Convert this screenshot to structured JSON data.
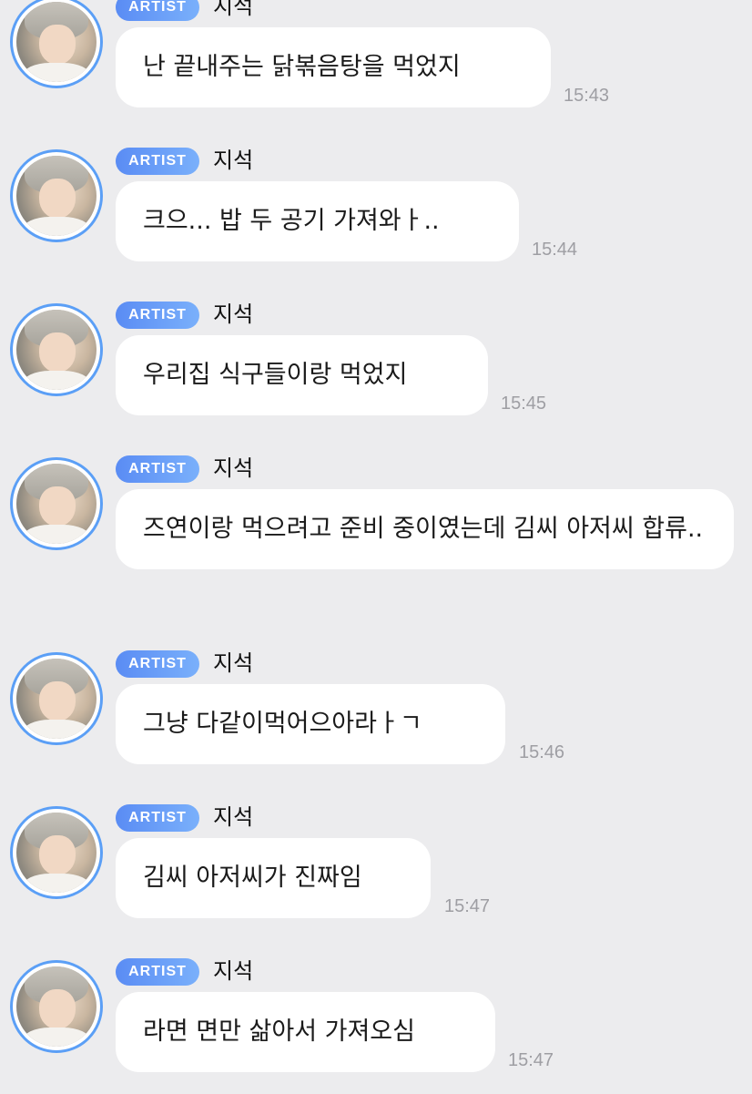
{
  "messages": [
    {
      "badge": "ARTIST",
      "sender": "지석",
      "text": "난 끝내주는 닭볶음탕을 먹었지",
      "time": "15:43"
    },
    {
      "badge": "ARTIST",
      "sender": "지석",
      "text": "크으... 밥 두 공기 가져와ㅏ..",
      "time": "15:44"
    },
    {
      "badge": "ARTIST",
      "sender": "지석",
      "text": "우리집 식구들이랑 먹었지",
      "time": "15:45"
    },
    {
      "badge": "ARTIST",
      "sender": "지석",
      "text": "즈연이랑 먹으려고 준비 중이였는데 김씨 아저씨 합류..",
      "time": ""
    },
    {
      "badge": "ARTIST",
      "sender": "지석",
      "text": "그냥 다같이먹어으아라ㅏㄱ",
      "time": "15:46"
    },
    {
      "badge": "ARTIST",
      "sender": "지석",
      "text": "김씨 아저씨가 진짜임",
      "time": "15:47"
    },
    {
      "badge": "ARTIST",
      "sender": "지석",
      "text": "라면 면만 삶아서 가져오심",
      "time": "15:47"
    }
  ],
  "avatar_icon": "profile-photo-avatar",
  "colors": {
    "background": "#ececee",
    "bubble": "#ffffff",
    "badge_start": "#5a8cf4",
    "badge_end": "#7ab0fb",
    "avatar_ring": "#5b9ff6",
    "timestamp": "#9e9ea3"
  }
}
